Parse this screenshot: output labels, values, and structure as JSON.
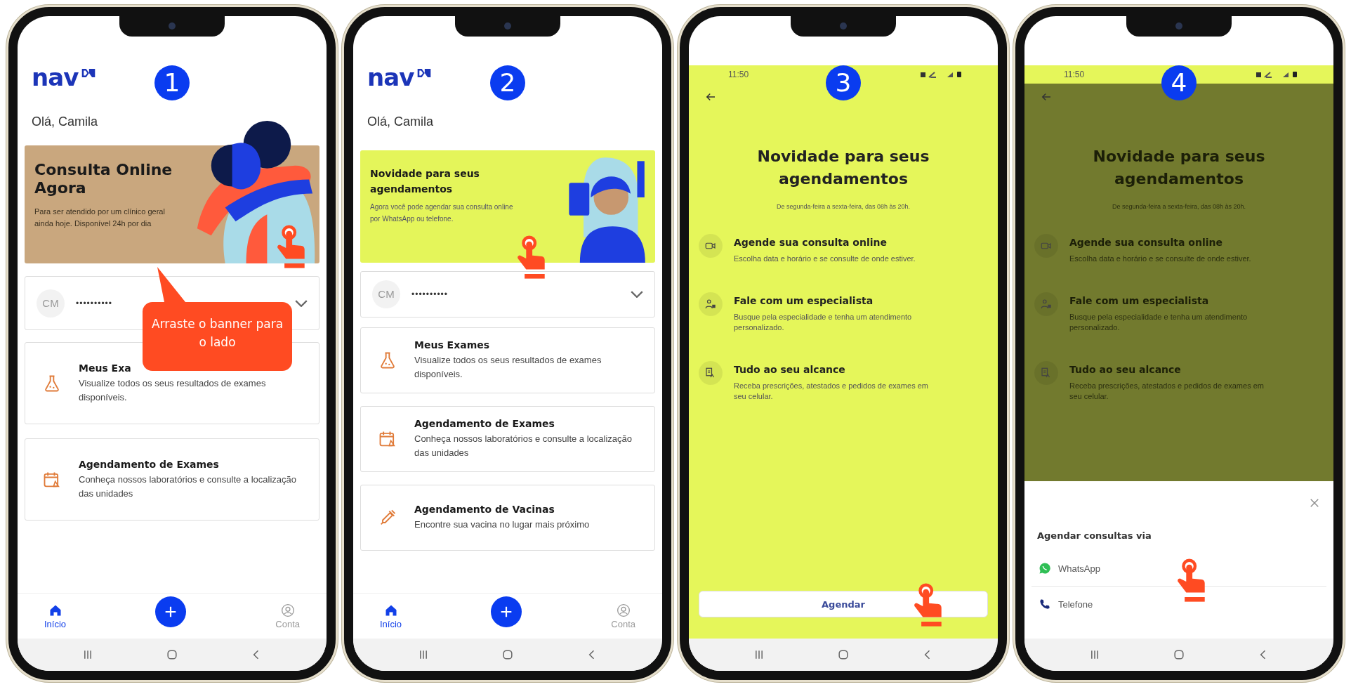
{
  "phones": [
    {
      "kind": "home",
      "step": "1",
      "logo": "nav",
      "greeting": "Olá, Camila",
      "banner": {
        "kind": "tan",
        "title": "Consulta Online Agora",
        "text": "Para ser atendido por um clínico geral ainda hoje. Disponível 24h por dia",
        "tap_hint": true
      },
      "account": {
        "initials": "CM",
        "masked": "••••••••••"
      },
      "cards": [
        {
          "title": "Meus Exa",
          "text": "Visualize todos os seus resultados de exames disponíveis."
        },
        {
          "title": "Agendamento de Exames",
          "text": "Conheça nossos laboratórios e consulte a localização das unidades"
        }
      ],
      "nav": [
        {
          "kind": "tab",
          "label": "Início",
          "selected": true
        },
        {
          "kind": "fab"
        },
        {
          "kind": "tab",
          "label": "Conta",
          "selected": false
        }
      ],
      "callout": "Arraste o banner para o lado"
    },
    {
      "kind": "home",
      "step": "2",
      "logo": "nav",
      "greeting": "Olá, Camila",
      "banner": {
        "kind": "lime",
        "title": "Novidade para seus agendamentos",
        "text": "Agora você pode agendar sua consulta online por WhatsApp ou telefone.",
        "tap_hint": true
      },
      "account": {
        "initials": "CM",
        "masked": "••••••••••"
      },
      "cards": [
        {
          "title": "Meus Exames",
          "text": "Visualize todos os seus resultados de exames disponíveis."
        },
        {
          "title": "Agendamento de Exames",
          "text": "Conheça nossos laboratórios e consulte a localização das unidades"
        },
        {
          "title": "Agendamento de Vacinas",
          "text": "Encontre sua vacina no lugar mais próximo"
        }
      ],
      "nav": [
        {
          "kind": "tab",
          "label": "Início",
          "selected": true
        },
        {
          "kind": "fab"
        },
        {
          "kind": "tab",
          "label": "Conta",
          "selected": false
        }
      ]
    },
    {
      "kind": "info",
      "step": "3",
      "dimmed": false,
      "status_time": "11:50",
      "title": "Novidade para seus agendamentos",
      "subtitle": "De segunda-feira a sexta-feira, das 08h às 20h.",
      "features": [
        {
          "title": "Agende sua consulta online",
          "text": "Escolha data e horário e se consulte de onde estiver."
        },
        {
          "title": "Fale com um especialista",
          "text": "Busque pela especialidade e tenha um atendimento personalizado."
        },
        {
          "title": "Tudo ao seu alcance",
          "text": "Receba prescrições, atestados e pedidos de exames em seu celular."
        }
      ],
      "button": {
        "label": "Agendar",
        "tap_hint": true
      }
    },
    {
      "kind": "info",
      "step": "4",
      "dimmed": true,
      "status_time": "11:50",
      "title": "Novidade para seus agendamentos",
      "subtitle": "De segunda-feira a sexta-feira, das 08h às 20h.",
      "features": [
        {
          "title": "Agende sua consulta online",
          "text": "Escolha data e horário e se consulte de onde estiver."
        },
        {
          "title": "Fale com um especialista",
          "text": "Busque pela especialidade e tenha um atendimento personalizado."
        },
        {
          "title": "Tudo ao seu alcance",
          "text": "Receba prescrições, atestados e pedidos de exames em seu celular."
        }
      ],
      "sheet": {
        "title": "Agendar consultas via",
        "options": [
          {
            "label": "WhatsApp",
            "tap_hint": true
          },
          {
            "label": "Telefone",
            "tap_hint": false
          }
        ]
      }
    }
  ]
}
